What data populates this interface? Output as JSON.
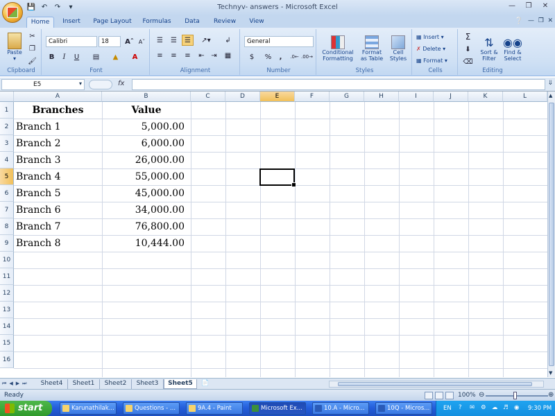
{
  "window": {
    "title": "Technyv- answers - Microsoft Excel"
  },
  "qat": {
    "icons": [
      "save-icon",
      "undo-icon",
      "redo-icon",
      "customize-icon"
    ]
  },
  "tabs": [
    "Home",
    "Insert",
    "Page Layout",
    "Formulas",
    "Data",
    "Review",
    "View"
  ],
  "ribbon": {
    "clipboard": {
      "label": "Clipboard",
      "paste": "Paste"
    },
    "font": {
      "label": "Font",
      "name": "Calibri",
      "size": "18"
    },
    "alignment": {
      "label": "Alignment"
    },
    "number": {
      "label": "Number",
      "format": "General",
      "currency": "$",
      "percent": "%",
      "comma": ","
    },
    "styles": {
      "label": "Styles",
      "conditional": "Conditional",
      "conditional2": "Formatting",
      "format_table": "Format",
      "format_table2": "as Table",
      "cell_styles": "Cell",
      "cell_styles2": "Styles"
    },
    "cells": {
      "label": "Cells",
      "insert": "Insert",
      "delete": "Delete",
      "format": "Format"
    },
    "editing": {
      "label": "Editing",
      "sort": "Sort &",
      "sort2": "Filter",
      "find": "Find &",
      "find2": "Select"
    }
  },
  "formula_bar": {
    "name_box": "E5",
    "fx": "fx",
    "formula": ""
  },
  "columns": [
    "A",
    "B",
    "C",
    "D",
    "E",
    "F",
    "G",
    "H",
    "I",
    "J",
    "K",
    "L"
  ],
  "rows": [
    "1",
    "2",
    "3",
    "4",
    "5",
    "6",
    "7",
    "8",
    "9",
    "10",
    "11",
    "12",
    "13",
    "14",
    "15",
    "16"
  ],
  "table": {
    "headers": [
      "Branches",
      "Value"
    ],
    "rows": [
      [
        "Branch 1",
        "5,000.00"
      ],
      [
        "Branch 2",
        "6,000.00"
      ],
      [
        "Branch 3",
        "26,000.00"
      ],
      [
        "Branch 4",
        "55,000.00"
      ],
      [
        "Branch 5",
        "45,000.00"
      ],
      [
        "Branch 6",
        "34,000.00"
      ],
      [
        "Branch 7",
        "76,800.00"
      ],
      [
        "Branch 8",
        "10,444.00"
      ]
    ]
  },
  "sheets": [
    "Sheet4",
    "Sheet1",
    "Sheet2",
    "Sheet3",
    "Sheet5"
  ],
  "active_sheet": "Sheet5",
  "status": {
    "text": "Ready",
    "zoom": "100%"
  },
  "taskbar": {
    "start": "start",
    "items": [
      "Karunathilak...",
      "Questions - ...",
      "9A.4 - Paint",
      "Microsoft Ex...",
      "10.A - Micro...",
      "10Q - Micros..."
    ],
    "lang": "EN",
    "clock": "9:30 PM"
  }
}
